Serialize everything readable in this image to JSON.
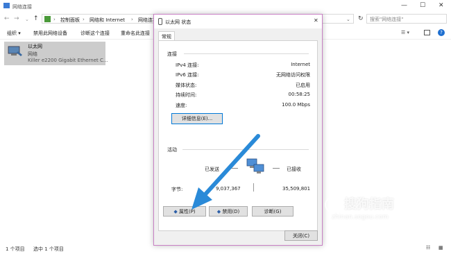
{
  "explorer": {
    "title": "网络连接",
    "breadcrumb": [
      "控制面板",
      "网络和 Internet",
      "网络连接"
    ],
    "search_placeholder": "搜索\"网络连接\"",
    "commands": [
      "组织 ▾",
      "禁用此网络设备",
      "诊断这个连接",
      "重命名此连接"
    ],
    "adapter": {
      "name": "以太网",
      "status": "网络",
      "device": "Killer e2200 Gigabit Ethernet C..."
    },
    "status_count": "1 个项目",
    "status_selected": "选中 1 个项目"
  },
  "dialog": {
    "title": "以太网 状态",
    "tab": "常规",
    "connection_header": "连接",
    "rows": [
      {
        "label": "IPv4 连接:",
        "value": "Internet"
      },
      {
        "label": "IPv6 连接:",
        "value": "无网络访问权限"
      },
      {
        "label": "媒体状态:",
        "value": "已启用"
      },
      {
        "label": "持续时间:",
        "value": "00:58:25"
      },
      {
        "label": "速度:",
        "value": "100.0 Mbps"
      }
    ],
    "details_button": "详细信息(E)...",
    "activity_header": "活动",
    "sent_label": "已发送",
    "received_label": "已接收",
    "bytes_label": "字节:",
    "bytes_sent": "9,037,367",
    "bytes_received": "35,509,801",
    "properties_button": "属性(P)",
    "disable_button": "禁用(D)",
    "diagnose_button": "诊断(G)",
    "close_button": "关闭(C)"
  },
  "watermark": {
    "text": "搜狗指南",
    "url": "zhinan.sogou.com"
  },
  "colors": {
    "arrow": "#2a8ad8",
    "dialog_border": "#c87fc4",
    "selected_item": "#cccccc"
  }
}
